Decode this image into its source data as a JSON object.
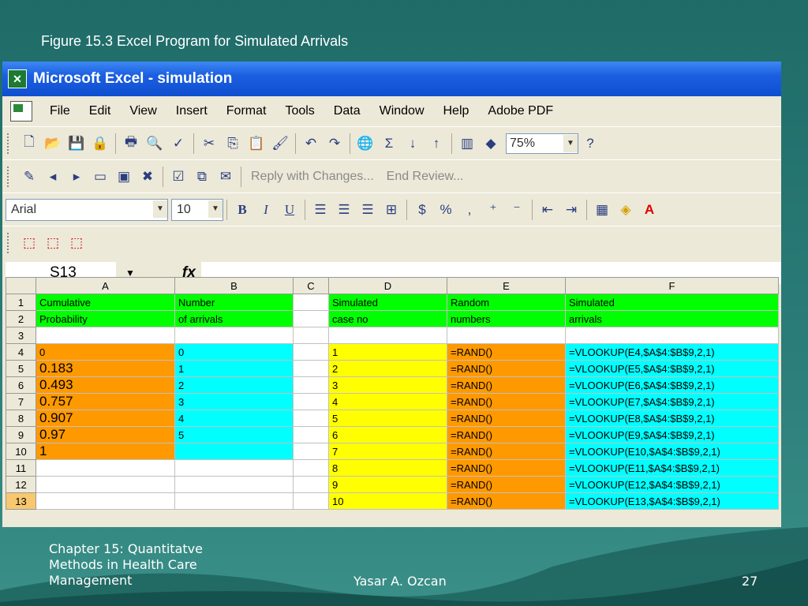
{
  "slide": {
    "title": "Figure 15.3 Excel Program for Simulated Arrivals",
    "footer_left": "Chapter 15: Quantitatve Methods in Health Care Management",
    "footer_center": "Yasar A. Ozcan",
    "footer_right": "27"
  },
  "window": {
    "title": "Microsoft Excel - simulation"
  },
  "menu": [
    "File",
    "Edit",
    "View",
    "Insert",
    "Format",
    "Tools",
    "Data",
    "Window",
    "Help",
    "Adobe PDF"
  ],
  "toolbar": {
    "zoom": "75%",
    "reply_label": "Reply with Changes...",
    "end_review_label": "End Review...",
    "font": "Arial",
    "font_size": "10"
  },
  "formula_bar": {
    "name_box": "S13",
    "fx": "fx",
    "formula": ""
  },
  "sheet": {
    "columns": [
      "A",
      "B",
      "C",
      "D",
      "E",
      "F"
    ],
    "rows": [
      {
        "n": "1",
        "a": "Cumulative",
        "b": "Number",
        "d": "Simulated",
        "e": "Random",
        "f": "Simulated"
      },
      {
        "n": "2",
        "a": "Probability",
        "b": "of arrivals",
        "d": "case no",
        "e": "numbers",
        "f": "arrivals"
      },
      {
        "n": "3",
        "a": "",
        "b": "",
        "d": "",
        "e": "",
        "f": ""
      },
      {
        "n": "4",
        "a": "0",
        "b": "0",
        "d": "1",
        "e": "=RAND()",
        "f": "=VLOOKUP(E4,$A$4:$B$9,2,1)"
      },
      {
        "n": "5",
        "a": "0.183",
        "b": "1",
        "d": "2",
        "e": "=RAND()",
        "f": "=VLOOKUP(E5,$A$4:$B$9,2,1)"
      },
      {
        "n": "6",
        "a": "0.493",
        "b": "2",
        "d": "3",
        "e": "=RAND()",
        "f": "=VLOOKUP(E6,$A$4:$B$9,2,1)"
      },
      {
        "n": "7",
        "a": "0.757",
        "b": "3",
        "d": "4",
        "e": "=RAND()",
        "f": "=VLOOKUP(E7,$A$4:$B$9,2,1)"
      },
      {
        "n": "8",
        "a": "0.907",
        "b": "4",
        "d": "5",
        "e": "=RAND()",
        "f": "=VLOOKUP(E8,$A$4:$B$9,2,1)"
      },
      {
        "n": "9",
        "a": "0.97",
        "b": "5",
        "d": "6",
        "e": "=RAND()",
        "f": "=VLOOKUP(E9,$A$4:$B$9,2,1)"
      },
      {
        "n": "10",
        "a": "1",
        "b": "",
        "d": "7",
        "e": "=RAND()",
        "f": "=VLOOKUP(E10,$A$4:$B$9,2,1)"
      },
      {
        "n": "11",
        "a": "",
        "b": "",
        "d": "8",
        "e": "=RAND()",
        "f": "=VLOOKUP(E11,$A$4:$B$9,2,1)"
      },
      {
        "n": "12",
        "a": "",
        "b": "",
        "d": "9",
        "e": "=RAND()",
        "f": "=VLOOKUP(E12,$A$4:$B$9,2,1)"
      },
      {
        "n": "13",
        "a": "",
        "b": "",
        "d": "10",
        "e": "=RAND()",
        "f": "=VLOOKUP(E13,$A$4:$B$9,2,1)"
      }
    ]
  }
}
